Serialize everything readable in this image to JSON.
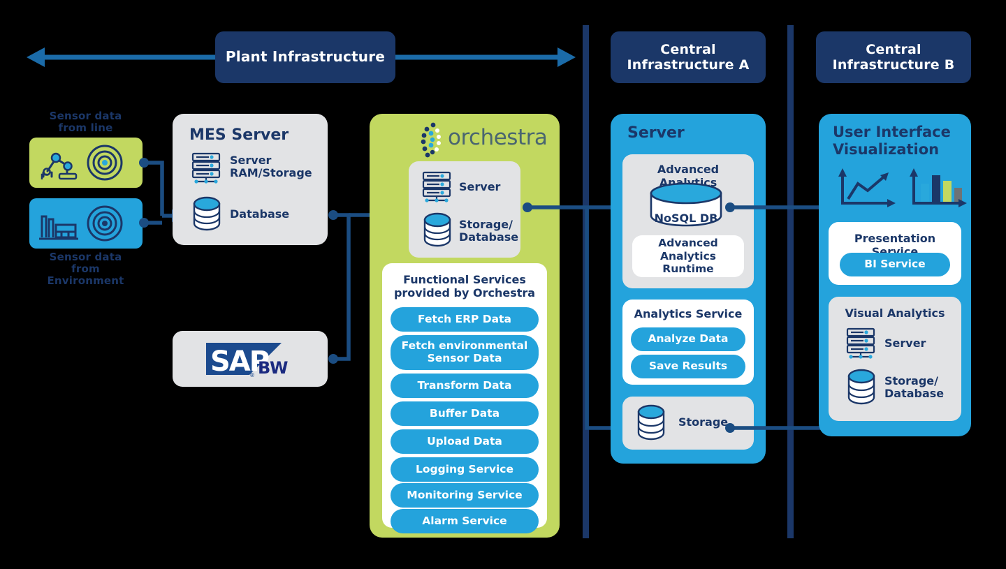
{
  "colors": {
    "navy": "#1B3768",
    "blue": "#24A3DC",
    "green": "#C2D860",
    "gray": "#E2E3E5",
    "line": "#1B4D82",
    "arrow": "#1B6BA8",
    "white": "#FFFFFF"
  },
  "headers": {
    "plant": "Plant Infrastructure",
    "central_a": "Central\nInfrastructure A",
    "central_b": "Central\nInfrastructure B"
  },
  "sensors": {
    "line_caption": "Sensor data\nfrom line",
    "env_caption": "Sensor data\nfrom\nEnvironment",
    "line_icons": [
      "robot-arm-icon",
      "sensor-target-icon"
    ],
    "env_icons": [
      "factory-icon",
      "sensor-target-icon"
    ]
  },
  "mes": {
    "title": "MES Server",
    "items": [
      {
        "icon": "server-rack-icon",
        "label": "Server\nRAM/Storage"
      },
      {
        "icon": "database-cylinder-icon",
        "label": "Database"
      }
    ]
  },
  "sap": {
    "logo_main": "SAP",
    "logo_sub": "BW",
    "logo_reg": "®"
  },
  "orchestra": {
    "logo_text": "orchestra",
    "logo_icon": "orchestra-dots-icon",
    "core_items": [
      {
        "icon": "server-rack-icon",
        "label": "Server"
      },
      {
        "icon": "database-cylinder-icon",
        "label": "Storage/\nDatabase"
      }
    ],
    "services_title": "Functional Services\nprovided by Orchestra",
    "services": [
      "Fetch ERP Data",
      "Fetch environmental\nSensor Data",
      "Transform Data",
      "Buffer Data",
      "Upload Data",
      "Logging Service",
      "Monitoring Service",
      "Alarm Service"
    ]
  },
  "central_a": {
    "panel_title": "Server",
    "advanced": {
      "title": "Advanced Analytics",
      "db_label": "NoSQL DB",
      "runtime_label": "Advanced Analytics\nRuntime"
    },
    "analytics_service": {
      "title": "Analytics Service",
      "actions": [
        "Analyze Data",
        "Save Results"
      ]
    },
    "storage": {
      "icon": "database-cylinder-icon",
      "label": "Storage"
    }
  },
  "central_b": {
    "panel_title": "User Interface\nVisualization",
    "chart_icons": [
      "line-chart-icon",
      "bar-chart-icon"
    ],
    "presentation": {
      "title": "Presentation Service",
      "pill": "BI Service"
    },
    "visual_analytics": {
      "title": "Visual Analytics",
      "items": [
        {
          "icon": "server-rack-icon",
          "label": "Server"
        },
        {
          "icon": "database-cylinder-icon",
          "label": "Storage/\nDatabase"
        }
      ]
    }
  },
  "bar_chart_colors": [
    "#29A8DC",
    "#1B3768",
    "#C2D860",
    "#6E7375"
  ]
}
